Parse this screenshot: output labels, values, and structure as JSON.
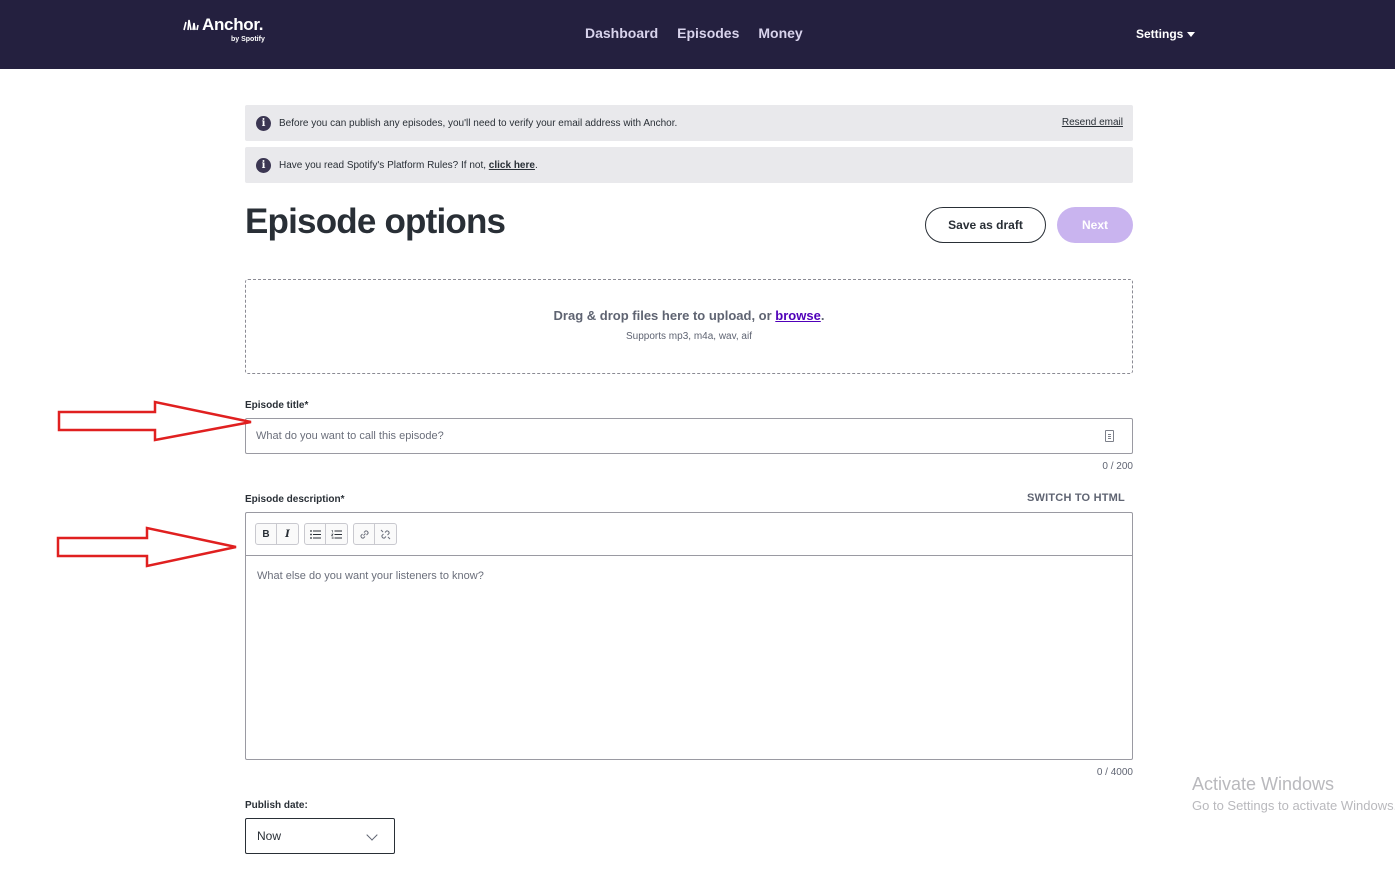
{
  "nav": {
    "logo_text": "Anchor.",
    "logo_sub": "by Spotify",
    "links": [
      "Dashboard",
      "Episodes",
      "Money"
    ],
    "settings": "Settings"
  },
  "banners": {
    "verify_text": "Before you can publish any episodes, you'll need to verify your email address with Anchor.",
    "resend_link": "Resend email",
    "rules_text": "Have you read Spotify's Platform Rules? If not, ",
    "rules_link": "click here",
    "rules_end": "."
  },
  "page": {
    "title": "Episode options",
    "save_draft": "Save as draft",
    "next": "Next"
  },
  "upload": {
    "main_text": "Drag & drop files here to upload, or ",
    "browse_link": "browse",
    "main_end": ".",
    "supports": "Supports mp3, m4a, wav, aif"
  },
  "episode_title": {
    "label": "Episode title*",
    "placeholder": "What do you want to call this episode?",
    "counter": "0  /  200"
  },
  "episode_description": {
    "label": "Episode description*",
    "switch_html": "SWITCH TO HTML",
    "toolbar": {
      "bold": "B",
      "italic": "I"
    },
    "placeholder": "What else do you want your listeners to know?",
    "counter": "0  /  4000"
  },
  "publish_date": {
    "label": "Publish date:",
    "value": "Now"
  },
  "watermark": {
    "line1": "Activate Windows",
    "line2": "Go to Settings to activate Windows."
  },
  "colors": {
    "nav_bg": "#24203f",
    "accent": "#5000b9",
    "next_disabled": "#c9b4ef",
    "annotation_arrow": "#e02020"
  }
}
